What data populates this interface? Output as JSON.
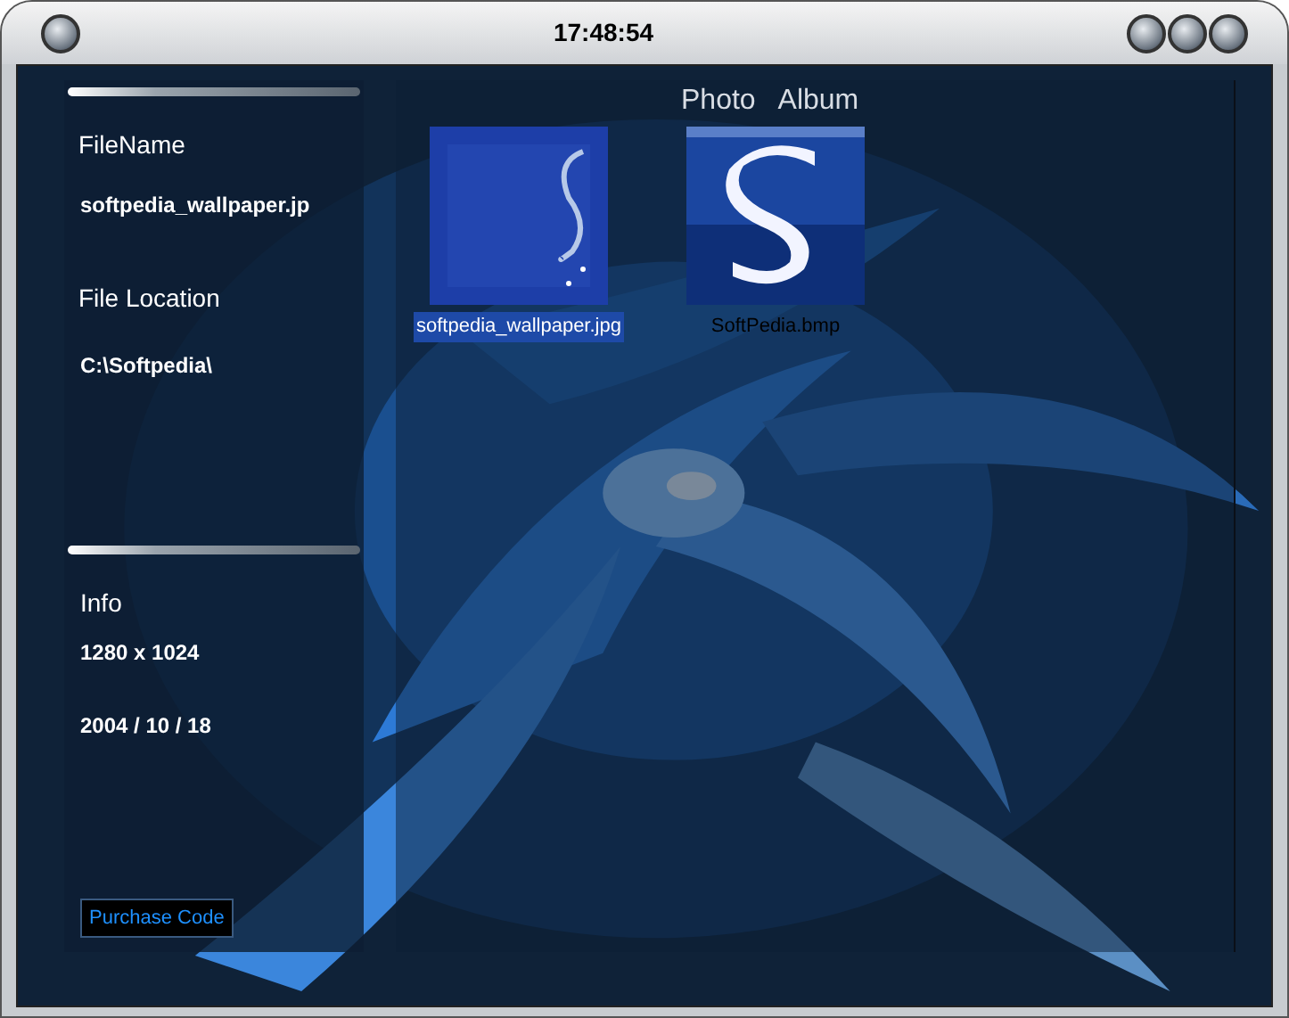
{
  "window": {
    "clock": "17:48:54"
  },
  "file_panel": {
    "filename_label": "FileName",
    "filename": "softpedia_wallpaper.jp",
    "location_label": "File Location",
    "location": "C:\\Softpedia\\"
  },
  "info_panel": {
    "label": "Info",
    "dimensions": "1280 x 1024",
    "date": "2004 / 10 / 18",
    "purchase_button": "Purchase Code"
  },
  "album": {
    "title": "Photo   Album",
    "items": [
      {
        "name": "softpedia_wallpaper.jpg",
        "selected": true,
        "kind": "wallpaper"
      },
      {
        "name": "SoftPedia.bmp",
        "selected": false,
        "kind": "logo"
      }
    ]
  }
}
